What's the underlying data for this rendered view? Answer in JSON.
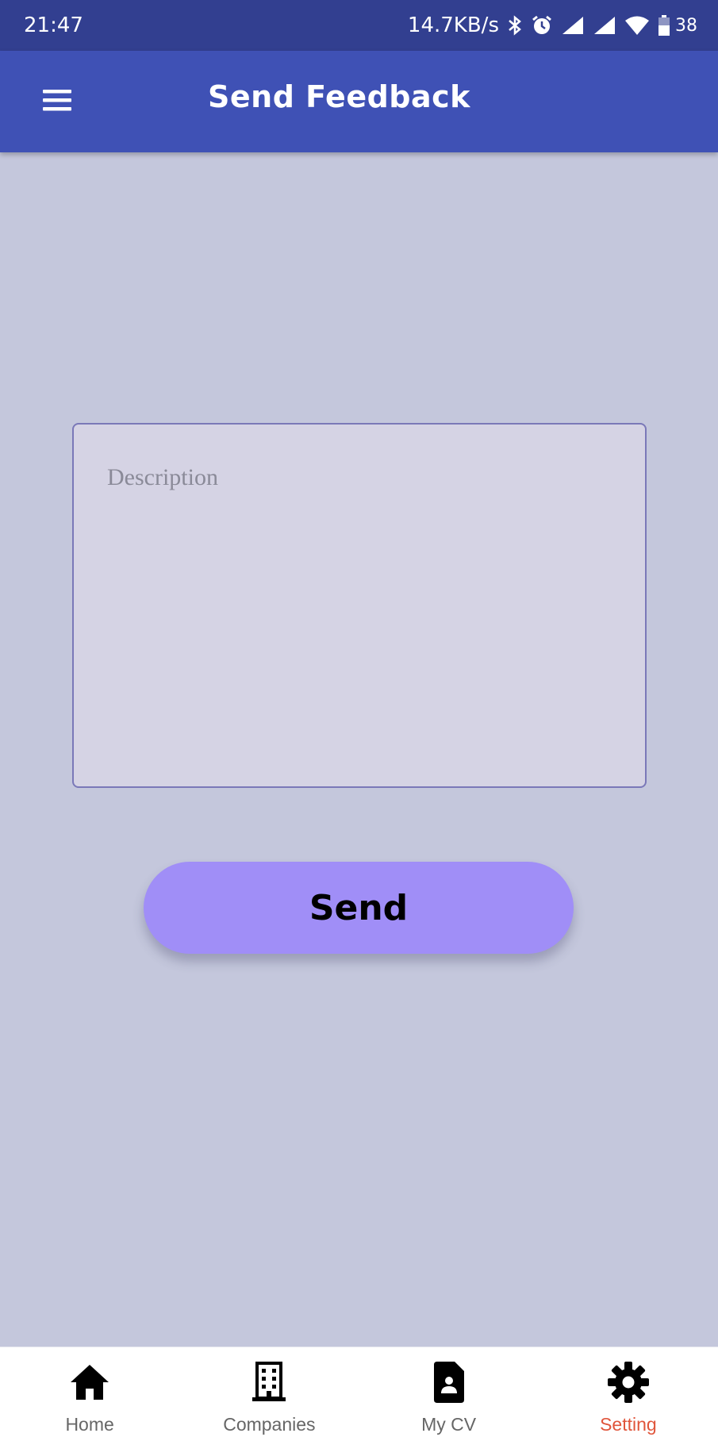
{
  "status_bar": {
    "time": "21:47",
    "network_speed": "14.7KB/s",
    "battery": "38",
    "icons": [
      "bluetooth-icon",
      "alarm-icon",
      "signal-icon",
      "signal-icon",
      "wifi-icon",
      "battery-icon"
    ]
  },
  "app_bar": {
    "title": "Send Feedback",
    "menu_icon": "hamburger-menu-icon"
  },
  "form": {
    "description_placeholder": "Description",
    "description_value": "",
    "send_label": "Send"
  },
  "bottom_nav": {
    "active_index": 3,
    "active_color": "#e0553b",
    "items": [
      {
        "label": "Home",
        "icon": "home-icon"
      },
      {
        "label": "Companies",
        "icon": "building-icon"
      },
      {
        "label": "My CV",
        "icon": "cv-document-icon"
      },
      {
        "label": "Setting",
        "icon": "gear-icon"
      }
    ]
  },
  "colors": {
    "status_bar": "#323f90",
    "app_bar": "#3f51b5",
    "background": "#c4c7dc",
    "input_fill": "#d5d3e4",
    "button": "#a08ef7"
  }
}
